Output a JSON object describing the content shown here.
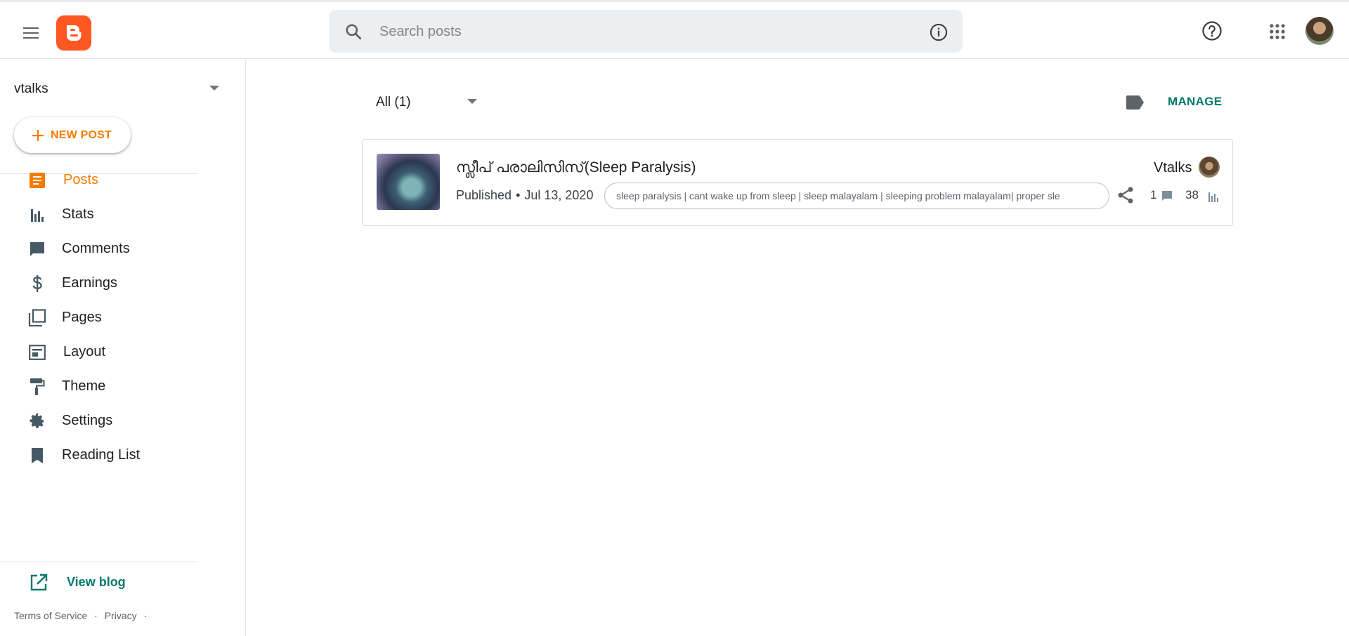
{
  "header": {
    "search_placeholder": "Search posts",
    "icons": {
      "menu": "hamburger-menu-icon",
      "logo": "blogger-logo",
      "search": "search-icon",
      "info": "info-icon",
      "help": "help-icon",
      "apps": "apps-grid-icon",
      "account": "account-avatar"
    }
  },
  "sidebar": {
    "blog_name": "vtalks",
    "new_post_label": "NEW POST",
    "items": [
      {
        "label": "Posts",
        "icon": "posts-icon",
        "active": true
      },
      {
        "label": "Stats",
        "icon": "stats-icon"
      },
      {
        "label": "Comments",
        "icon": "comment-icon"
      },
      {
        "label": "Earnings",
        "icon": "dollar-icon"
      },
      {
        "label": "Pages",
        "icon": "pages-icon"
      },
      {
        "label": "Layout",
        "icon": "layout-icon"
      },
      {
        "label": "Theme",
        "icon": "paint-roller-icon"
      },
      {
        "label": "Settings",
        "icon": "gear-icon"
      },
      {
        "label": "Reading List",
        "icon": "bookmark-icon"
      }
    ],
    "view_blog_label": "View blog",
    "footer_links": [
      "Terms of Service",
      "·",
      "Privacy",
      "·"
    ]
  },
  "main": {
    "filter_label": "All (1)",
    "manage_label": "MANAGE",
    "posts": [
      {
        "title": "സ്ലീപ് പരാലിസിസ്(Sleep Paralysis)",
        "status": "Published",
        "separator": "•",
        "date": "Jul 13, 2020",
        "labels": "sleep paralysis | cant wake up from sleep | sleep malayalam | sleeping problem malayalam| proper sle",
        "author": "Vtalks",
        "comments": "1",
        "views": "38"
      }
    ]
  },
  "colors": {
    "accent_orange": "#f57c00",
    "teal": "#00796b",
    "logo_orange": "#ff5722"
  }
}
